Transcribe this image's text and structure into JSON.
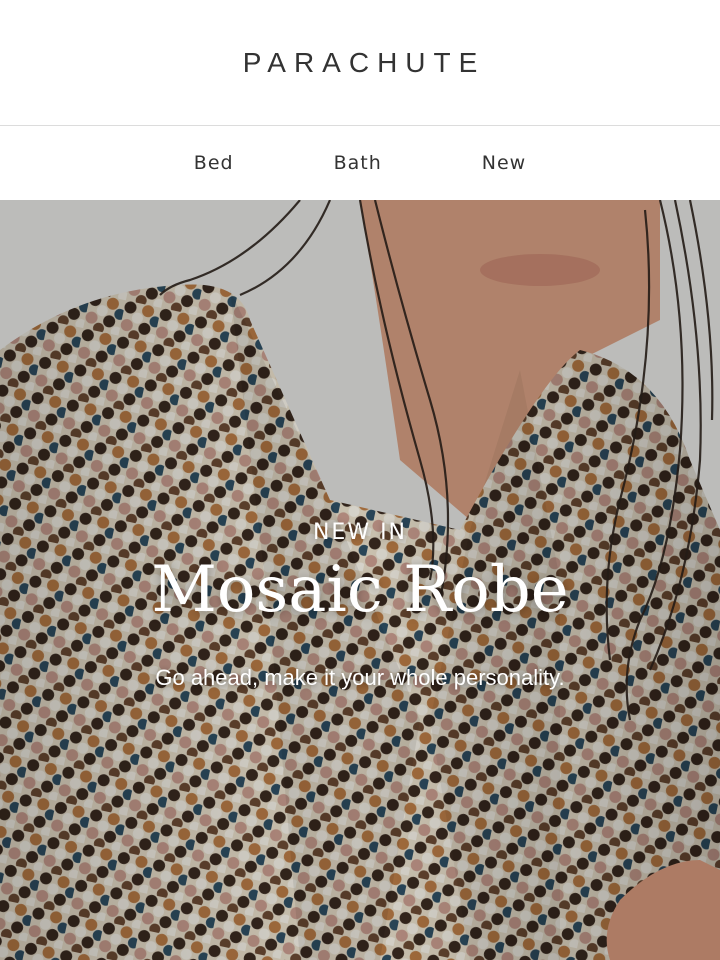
{
  "brand": {
    "logo": "PARACHUTE"
  },
  "nav": {
    "items": [
      "Bed",
      "Bath",
      "New"
    ]
  },
  "hero": {
    "eyebrow": "NEW IN",
    "headline": "Mosaic Robe",
    "subhead": "Go ahead, make it your whole personality.",
    "image_label": "person wearing mosaic towel robe"
  },
  "colors": {
    "text": "#2d2d2d",
    "divider": "#dcdcdc",
    "hero_text": "#ffffff",
    "robe_palette": [
      "#3a2a20",
      "#6b4a33",
      "#b77a45",
      "#e6dcc8",
      "#2f4f63",
      "#c79b8d",
      "#f3efe5"
    ]
  }
}
